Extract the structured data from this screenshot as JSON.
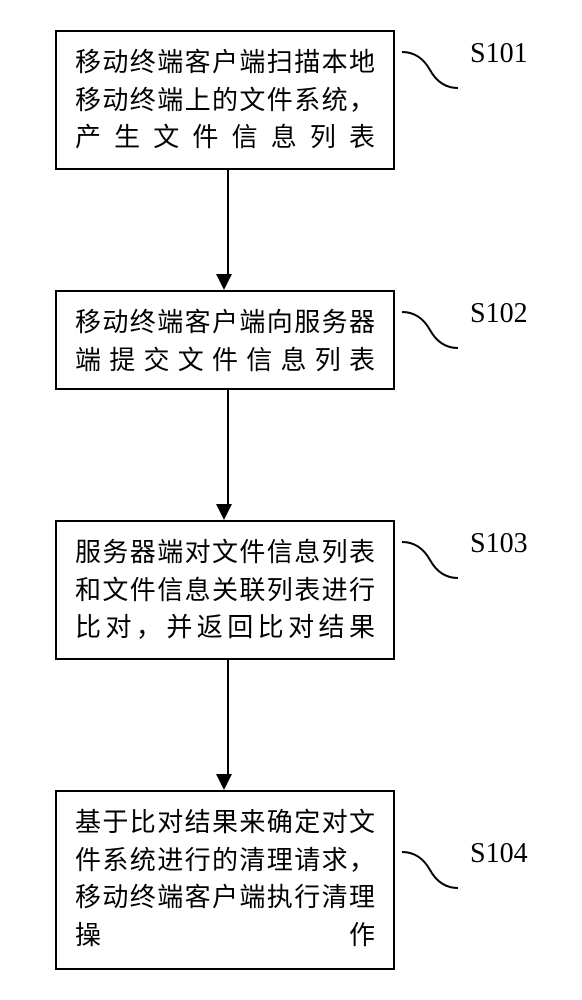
{
  "flowchart": {
    "steps": [
      {
        "label": "S101",
        "text": "移动终端客户端扫描本地移动终端上的文件系统，产生文件信息列表"
      },
      {
        "label": "S102",
        "text": "移动终端客户端向服务器端提交文件信息列表"
      },
      {
        "label": "S103",
        "text": "服务器端对文件信息列表和文件信息关联列表进行比对，并返回比对结果"
      },
      {
        "label": "S104",
        "text": "基于比对结果来确定对文件系统进行的清理请求，移动终端客户端执行清理操作"
      }
    ]
  }
}
